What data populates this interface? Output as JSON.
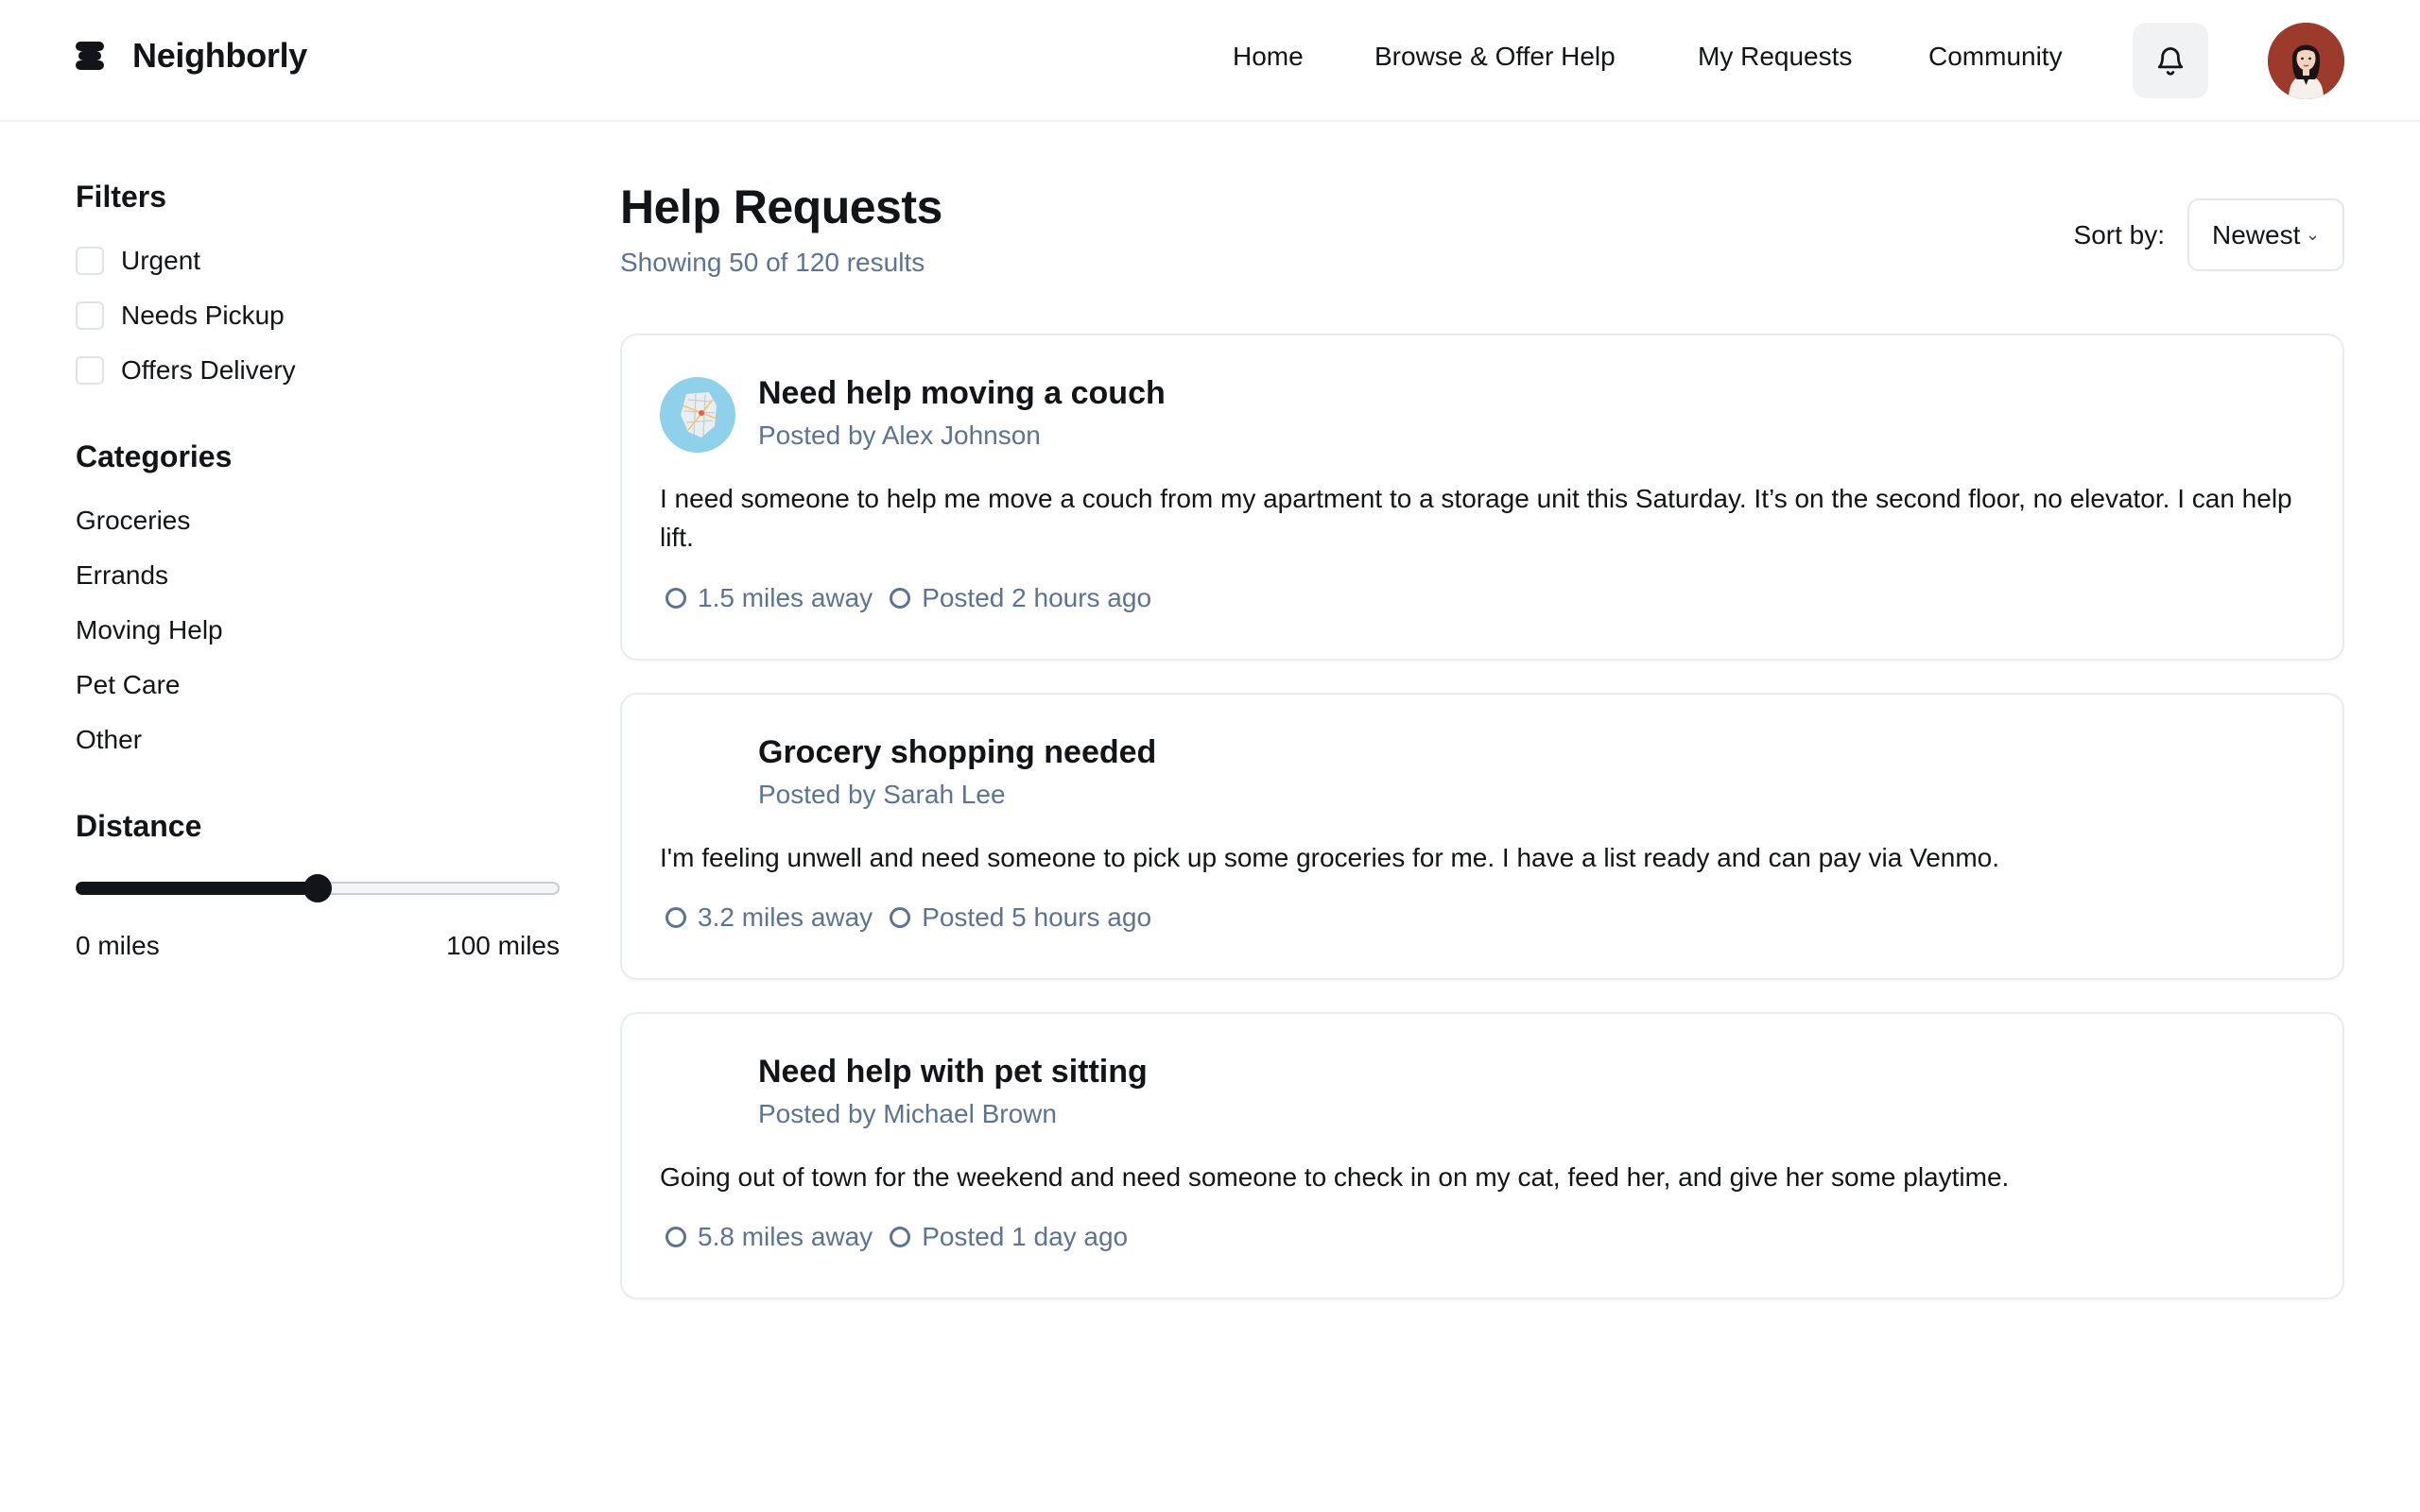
{
  "app": {
    "name": "Neighborly",
    "logo_icon": "stack-logo-icon"
  },
  "nav": {
    "items": [
      {
        "label": "Home"
      },
      {
        "label": "Browse & Offer Help"
      },
      {
        "label": "My Requests"
      },
      {
        "label": "Community"
      }
    ],
    "notifications_icon": "bell-icon",
    "profile_avatar": "user-avatar"
  },
  "sidebar": {
    "filters_heading": "Filters",
    "filters": [
      {
        "label": "Urgent",
        "checked": false
      },
      {
        "label": "Needs Pickup",
        "checked": false
      },
      {
        "label": "Offers Delivery",
        "checked": false
      }
    ],
    "categories_heading": "Categories",
    "categories": [
      "Groceries",
      "Errands",
      "Moving Help",
      "Pet Care",
      "Other"
    ],
    "distance_heading": "Distance",
    "distance": {
      "min_label": "0 miles",
      "max_label": "100 miles",
      "min": 0,
      "max": 100,
      "value": 50
    }
  },
  "main": {
    "title": "Help Requests",
    "result_count": "Showing 50 of 120 results",
    "sort_label": "Sort by:",
    "sort_value": "Newest",
    "requests": [
      {
        "title": "Need help moving a couch",
        "author": "Posted by Alex Johnson",
        "body": "I need someone to help me move a couch from my apartment to a storage unit this Saturday. It’s on the second floor, no elevator. I can help lift.",
        "distance": "1.5 miles away",
        "posted": "Posted 2 hours ago",
        "has_avatar": true
      },
      {
        "title": "Grocery shopping needed",
        "author": "Posted by Sarah Lee",
        "body": "I'm feeling unwell and need someone to pick up some groceries for me. I have a list ready and can pay via Venmo.",
        "distance": "3.2 miles away",
        "posted": "Posted 5 hours ago",
        "has_avatar": false
      },
      {
        "title": "Need help with pet sitting",
        "author": "Posted by Michael Brown",
        "body": "Going out of town for the weekend and need someone to check in on my cat, feed her, and give her some playtime.",
        "distance": "5.8 miles away",
        "posted": "Posted 1 day ago",
        "has_avatar": false
      }
    ]
  },
  "colors": {
    "text": "#111418",
    "muted": "#5d7390",
    "border": "#e8ebef",
    "avatar_bg": "#9c3a2c"
  }
}
